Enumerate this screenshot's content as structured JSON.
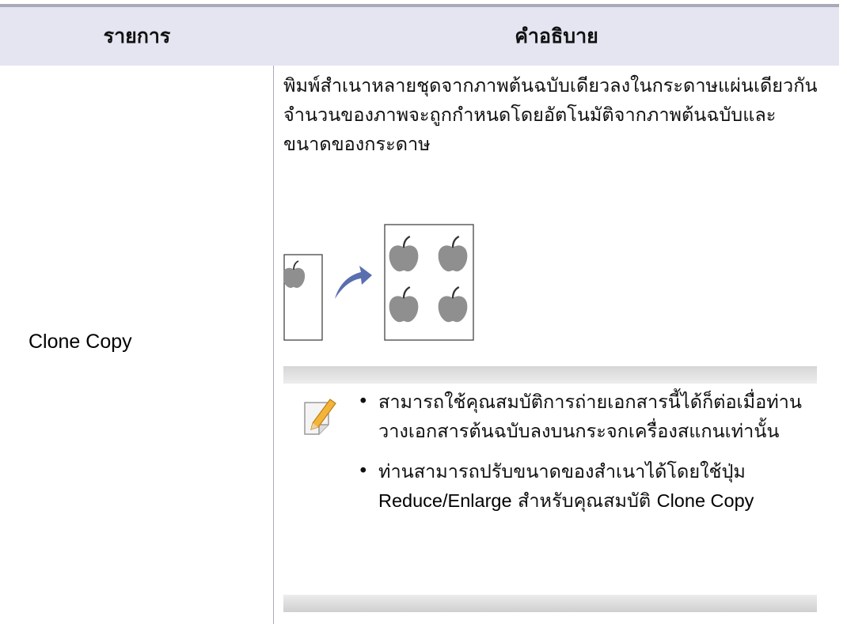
{
  "table": {
    "headers": {
      "item": "รายการ",
      "description": "คำอธิบาย"
    },
    "rows": [
      {
        "item": "Clone Copy",
        "description": [
          "พิมพ์สำเนาหลายชุดจากภาพต้นฉบับเดียวลงในกระดาษแผ่นเดียวกัน",
          "จำนวนของภาพจะถูกกำหนดโดยอัตโนมัติจากภาพต้นฉบับและขนาดของกระดาษ"
        ],
        "illustration": {
          "source_images": 1,
          "output_images": 4,
          "icon": "apple-icon",
          "arrow": "curved-arrow-icon"
        },
        "note": {
          "icon": "note-pencil-icon",
          "bullet_1": "สามารถใช้คุณสมบัติการถ่ายเอกสารนี้ได้ก็ต่อเมื่อท่านวางเอกสารต้นฉบับลงบนกระจกเครื่องสแกนเท่านั้น",
          "bullet_2_prefix": "ท่านสามารถปรับขนาดของสำเนาได้โดยใช้ปุ่ม",
          "bullet_2_button": "Reduce/Enlarge",
          "bullet_2_middle": "สำหรับคุณสมบัติ",
          "bullet_2_feature": "Clone Copy"
        }
      }
    ]
  },
  "colors": {
    "header_bg": "#e4e5f1",
    "rule": "#a9aab8",
    "arrow": "#5a6fae",
    "apple": "#8f8f8f"
  }
}
